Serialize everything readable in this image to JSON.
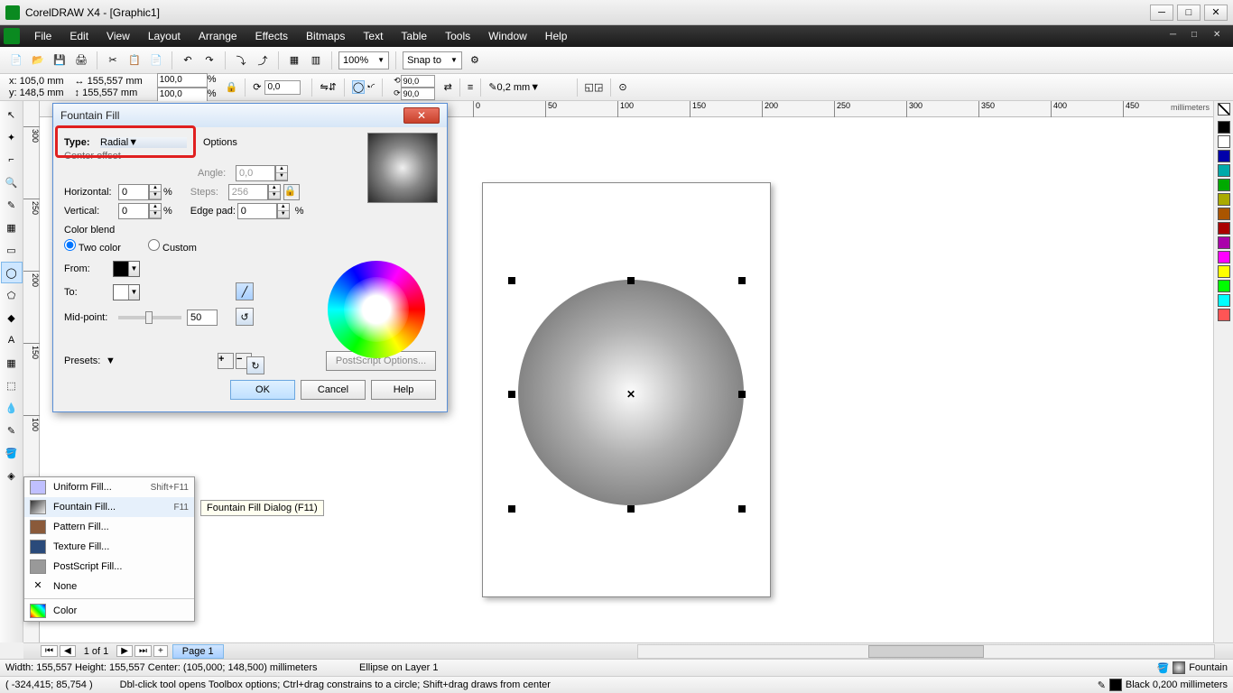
{
  "title": "CorelDRAW X4 - [Graphic1]",
  "menu": [
    "File",
    "Edit",
    "View",
    "Layout",
    "Arrange",
    "Effects",
    "Bitmaps",
    "Text",
    "Table",
    "Tools",
    "Window",
    "Help"
  ],
  "toolbar_zoom": "100%",
  "toolbar_snap": "Snap to",
  "propbar": {
    "x": "x: 105,0 mm",
    "y": "y: 148,5 mm",
    "w": "155,557 mm",
    "h": "155,557 mm",
    "sx": "100,0",
    "sy": "100,0",
    "pct": "%",
    "rot": "0,0",
    "arc1": "90,0",
    "arc2": "90,0",
    "outline": "0,2 mm"
  },
  "ruler_unit": "millimeters",
  "ruler_h": [
    "0",
    "50",
    "100",
    "150",
    "200",
    "250",
    "300",
    "350",
    "400",
    "450"
  ],
  "ruler_v": [
    "300",
    "250",
    "200",
    "150",
    "100"
  ],
  "dialog": {
    "title": "Fountain Fill",
    "type_label": "Type:",
    "type_value": "Radial",
    "center_offset": "Center offset",
    "horizontal": "Horizontal:",
    "horizontal_val": "0",
    "vertical": "Vertical:",
    "vertical_val": "0",
    "pct": "%",
    "options": "Options",
    "angle": "Angle:",
    "angle_val": "0,0",
    "steps": "Steps:",
    "steps_val": "256",
    "edge_pad": "Edge pad:",
    "edge_pad_val": "0",
    "color_blend": "Color blend",
    "two_color": "Two color",
    "custom": "Custom",
    "from": "From:",
    "to": "To:",
    "midpoint": "Mid-point:",
    "midpoint_val": "50",
    "presets": "Presets:",
    "postscript": "PostScript Options...",
    "ok": "OK",
    "cancel": "Cancel",
    "help": "Help"
  },
  "flyout": {
    "items": [
      {
        "label": "Uniform Fill...",
        "shortcut": "Shift+F11",
        "icon": "#c0c0ff"
      },
      {
        "label": "Fountain Fill...",
        "shortcut": "F11",
        "icon": "grad"
      },
      {
        "label": "Pattern Fill...",
        "shortcut": "",
        "icon": "#8a5a3a"
      },
      {
        "label": "Texture Fill...",
        "shortcut": "",
        "icon": "#2a4a7a"
      },
      {
        "label": "PostScript Fill...",
        "shortcut": "",
        "icon": "#999"
      },
      {
        "label": "None",
        "shortcut": "",
        "icon": "none"
      }
    ],
    "color": "Color"
  },
  "tooltip": "Fountain Fill Dialog (F11)",
  "pagenav": {
    "pages": "1 of 1",
    "tab": "Page 1"
  },
  "status1": {
    "left": "Width: 155,557 Height: 155,557 Center: (105,000; 148,500)  millimeters",
    "mid": "Ellipse on Layer 1",
    "fill": "Fountain",
    "outline": "Black  0,200 millimeters"
  },
  "status2": {
    "coords": "( -324,415; 85,754 )",
    "hint": "Dbl-click tool opens Toolbox options; Ctrl+drag constrains to a circle; Shift+drag draws from center"
  },
  "colors": [
    "#000",
    "#fff",
    "#00a",
    "#0aa",
    "#0a0",
    "#aa0",
    "#a50",
    "#a00",
    "#a0a",
    "#f0f",
    "#ff0",
    "#0f0",
    "#0ff",
    "#f55"
  ]
}
